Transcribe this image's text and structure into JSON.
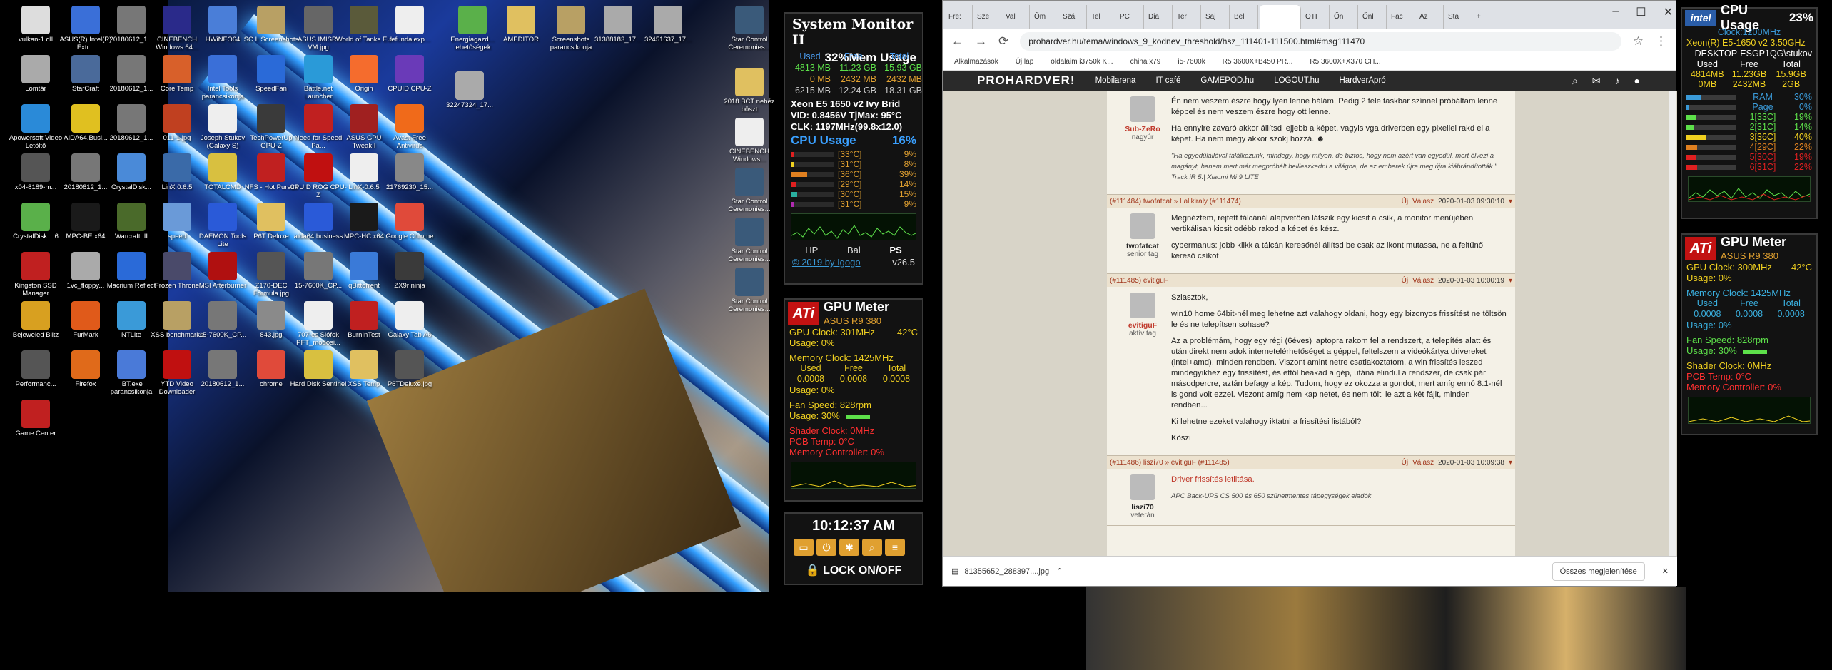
{
  "desktop_icons": [
    {
      "label": "vulkan-1.dll",
      "color": "#dddddd"
    },
    {
      "label": "ASUS(R) Intel(R) Extr...",
      "color": "#3a6fd8"
    },
    {
      "label": "20180612_1...",
      "color": "#777777"
    },
    {
      "label": "CINEBENCH Windows 64...",
      "color": "#2a2a8a"
    },
    {
      "label": "HWiNFO64",
      "color": "#4a7ed8"
    },
    {
      "label": "SC II Screenshots",
      "color": "#b8a064"
    },
    {
      "label": "ASUS IMISR-VM.jpg",
      "color": "#666666"
    },
    {
      "label": "World of Tanks EU",
      "color": "#5a5a3a"
    },
    {
      "label": "refundalexp...",
      "color": "#eeeeee"
    },
    {
      "label": "Lomtár",
      "color": "#aaaaaa"
    },
    {
      "label": "StarCraft",
      "color": "#4a6a9a"
    },
    {
      "label": "20180612_1...",
      "color": "#777777"
    },
    {
      "label": "Core Temp",
      "color": "#d8602a"
    },
    {
      "label": "Intel Tools parancsikonja",
      "color": "#3a6fd8"
    },
    {
      "label": "SpeedFan",
      "color": "#2a6ad8"
    },
    {
      "label": "Battle.net Launcher",
      "color": "#2a9ad8"
    },
    {
      "label": "Origin",
      "color": "#f56c2d"
    },
    {
      "label": "CPUID CPU-Z",
      "color": "#6a3ab8"
    },
    {
      "label": "Apowersoft Video Letöltő",
      "color": "#2a8ad8"
    },
    {
      "label": "AIDA64.Busi...",
      "color": "#e0c020"
    },
    {
      "label": "20180612_1...",
      "color": "#777777"
    },
    {
      "label": "011-1.jpg",
      "color": "#c04020"
    },
    {
      "label": "Joseph Stukov (Galaxy S)",
      "color": "#eeeeee"
    },
    {
      "label": "TechPowerUp GPU-Z",
      "color": "#3a3a3a"
    },
    {
      "label": "Need for Speed Pa...",
      "color": "#c02020"
    },
    {
      "label": "ASUS GPU TweakII",
      "color": "#a02020"
    },
    {
      "label": "Avast Free Antivirus",
      "color": "#f06a1a"
    },
    {
      "label": "x04-8189-m...",
      "color": "#555555"
    },
    {
      "label": "20180612_1...",
      "color": "#777777"
    },
    {
      "label": "CrystalDisk...",
      "color": "#4a8ad8"
    },
    {
      "label": "LinX 0.6.5",
      "color": "#3a6aa8"
    },
    {
      "label": "TOTALCMD",
      "color": "#d8c040"
    },
    {
      "label": "NFS - Hot Pursuit",
      "color": "#c02020"
    },
    {
      "label": "CPUID ROG CPU-Z",
      "color": "#c01010"
    },
    {
      "label": "LinX-0.6.5",
      "color": "#eeeeee"
    },
    {
      "label": "21769230_15...",
      "color": "#888888"
    },
    {
      "label": "CrystalDisk... 6",
      "color": "#5ab04a"
    },
    {
      "label": "MPC-BE x64",
      "color": "#1a1a1a"
    },
    {
      "label": "Warcraft III",
      "color": "#4a6a2a"
    },
    {
      "label": "speed",
      "color": "#6a9ad8"
    },
    {
      "label": "DAEMON Tools Lite",
      "color": "#2a5ad8"
    },
    {
      "label": "P6T Deluxe",
      "color": "#e0c060"
    },
    {
      "label": "aida64 business",
      "color": "#2a5ad8"
    },
    {
      "label": "MPC-HC x64",
      "color": "#1a1a1a"
    },
    {
      "label": "Google Chrome",
      "color": "#e04a3a"
    },
    {
      "label": "Kingston SSD Manager",
      "color": "#c02020"
    },
    {
      "label": "1vc_floppy...",
      "color": "#aaaaaa"
    },
    {
      "label": "Macrium Reflect",
      "color": "#2a6ad8"
    },
    {
      "label": "Frozen Throne",
      "color": "#4a4a6a"
    },
    {
      "label": "MSI Afterburner",
      "color": "#b01010"
    },
    {
      "label": "Z170-DEC Formula.jpg",
      "color": "#555555"
    },
    {
      "label": "15-7600K_CP...",
      "color": "#777777"
    },
    {
      "label": "qBittorrent",
      "color": "#3a7ad8"
    },
    {
      "label": "ZX9r ninja",
      "color": "#3a3a3a"
    },
    {
      "label": "Bejeweled Blitz",
      "color": "#d8a020"
    },
    {
      "label": "FurMark",
      "color": "#e05a1a"
    },
    {
      "label": "NTLite",
      "color": "#3a9ad8"
    },
    {
      "label": "XSS benchmarks",
      "color": "#b8a064"
    },
    {
      "label": "15-7600K_CP...",
      "color": "#777777"
    },
    {
      "label": "843.jpg",
      "color": "#8a8a8a"
    },
    {
      "label": "707-es Siófok PFT_modosi...",
      "color": "#eeeeee"
    },
    {
      "label": "BurnInTest",
      "color": "#c02020"
    },
    {
      "label": "Galaxy Tab A6",
      "color": "#eeeeee"
    },
    {
      "label": "Performanc...",
      "color": "#555555"
    },
    {
      "label": "Firefox",
      "color": "#e06a1a"
    },
    {
      "label": "IBT.exe parancsikonja",
      "color": "#4a7ad8"
    },
    {
      "label": "YTD Video Downloader",
      "color": "#c01010"
    },
    {
      "label": "20180612_1...",
      "color": "#777777"
    },
    {
      "label": "chrome",
      "color": "#e04a3a"
    },
    {
      "label": "Hard Disk Sentinel",
      "color": "#d8c040"
    },
    {
      "label": "XSS Temp",
      "color": "#e0c060"
    },
    {
      "label": "P6TDeluxe.jpg",
      "color": "#555555"
    },
    {
      "label": "Game Center",
      "color": "#c02020"
    },
    {
      "label": "Energiagazd... lehetőségek",
      "color": "#5ab04a"
    },
    {
      "label": "AMEDITOR",
      "color": "#e0c060"
    },
    {
      "label": "Screenshots parancsikonja",
      "color": "#b8a064"
    },
    {
      "label": "31388183_17...",
      "color": "#aaaaaa"
    },
    {
      "label": "32451637_17...",
      "color": "#aaaaaa"
    },
    {
      "label": "32247324_17...",
      "color": "#aaaaaa"
    },
    {
      "label": "2018 BCT nehéz böszt",
      "color": "#e0c060"
    },
    {
      "label": "CINEBENCH Windows...",
      "color": "#eeeeee"
    },
    {
      "label": "Star Control Ceremonies...",
      "color": "#3a5a7a"
    },
    {
      "label": "Star Control Ceremonies...",
      "color": "#3a5a7a"
    },
    {
      "label": "Star Control Ceremonies...",
      "color": "#3a5a7a"
    },
    {
      "label": "Star Control Ceremonies...",
      "color": "#3a5a7a"
    }
  ],
  "sysmon": {
    "title": "System Monitor II",
    "mem_label": "Mem Usage",
    "mem_pct": "32%",
    "cols": [
      "Used",
      "Free",
      "Total"
    ],
    "rows": [
      [
        "4813 MB",
        "11.23 GB",
        "15.93 GB"
      ],
      [
        "0 MB",
        "2432 MB",
        "2432 MB"
      ],
      [
        "6215 MB",
        "12.24 GB",
        "18.31 GB"
      ]
    ],
    "cpu_name": "Xeon E5 1650 v2 Ivy Brid",
    "vid": "VID: 0.8456V TjMax: 95°C",
    "clk": "CLK:  1197MHz(99.8x12.0)",
    "cpu_label": "CPU Usage",
    "cpu_pct": "16%",
    "cores": [
      {
        "temp": "[33°C]",
        "pct": "9%",
        "color": "#e02020",
        "level": 9
      },
      {
        "temp": "[31°C]",
        "pct": "8%",
        "color": "#f0d020",
        "level": 8
      },
      {
        "temp": "[36°C]",
        "pct": "39%",
        "color": "#e08020",
        "level": 39
      },
      {
        "temp": "[29°C]",
        "pct": "14%",
        "color": "#e02020",
        "level": 14
      },
      {
        "temp": "[30°C]",
        "pct": "15%",
        "color": "#2ab0a0",
        "level": 15
      },
      {
        "temp": "[31°C]",
        "pct": "9%",
        "color": "#b02ab0",
        "level": 9
      }
    ],
    "footer": [
      "HP",
      "Bal",
      "PS"
    ],
    "copyright": "© 2019 by Igogo",
    "version": "v26.5"
  },
  "gpu_left": {
    "title": "GPU Meter",
    "model": "ASUS R9 380",
    "clock": "GPU Clock: 301MHz",
    "temp": "42°C",
    "usage": "Usage: 0%",
    "memclock": "Memory Clock: 1425MHz",
    "cols": [
      "Used",
      "Free",
      "Total"
    ],
    "vals": [
      "0.0008",
      "0.0008",
      "0.0008"
    ],
    "musage": "Usage: 0%",
    "fan": "Fan Speed: 828rpm",
    "fan_usage": "Usage: 30%",
    "fan_level": 30,
    "shader": "Shader Clock: 0MHz",
    "pcb": "PCB Temp: 0°C",
    "memctrl": "Memory Controller: 0%"
  },
  "clock": {
    "time": "10:12:37 AM",
    "lock": "LOCK ON/OFF"
  },
  "browser": {
    "tabs": [
      "Fre:",
      "Sze",
      "Val",
      "Őm",
      "Szá",
      "Tel",
      "PC",
      "Dia",
      "Ter",
      "Saj",
      "Bel",
      "",
      "OTI",
      "Őn",
      "Őnl",
      "Fac",
      "Az",
      "Sta"
    ],
    "url": "prohardver.hu/tema/windows_9_kodnev_threshold/hsz_111401-111500.html#msg111470",
    "bookmarks": [
      "Alkalmazások",
      "Új lap",
      "oldalaim i3750k K...",
      "china x79",
      "i5-7600k",
      "R5 3600X+B450 PR...",
      "R5 3600X+X370 CH..."
    ],
    "nav": [
      "PROHARDVER!",
      "Mobilarena",
      "IT café",
      "GAMEPOD.hu",
      "LOGOUT.hu",
      "HardverApró"
    ],
    "download_file": "81355652_288397....jpg",
    "download_btn": "Összes megjelenítése"
  },
  "posts": [
    {
      "bar": null,
      "user": "Sub-ZeRo",
      "rank": "nagyúr",
      "red": true,
      "paras": [
        "Én nem veszem észre hogy lyen lenne hálám. Pedig 2 féle taskbar színnel próbáltam lenne képpel és nem veszem észre hogy ott lenne.",
        "Ha ennyire zavaró akkor állítsd lejjebb a képet, vagyis vga driverben egy pixellel rakd el a képet. Ha nem megy akkor szokj hozzá. ☻"
      ],
      "sig": "\"Ha egyedülállóval találkozunk, mindegy, hogy milyen, de biztos, hogy nem azért van egyedül, mert élvezi a magányt, hanem mert már megpróbált beilleszkedni a világba, de az emberek újra meg újra kiábrándították.\" Track iR 5.| Xiaomi Mi 9 LITE"
    },
    {
      "bar": "(#111484) twofatcat » Lalikiraly (#111474)",
      "date": "2020-01-03 09:30:10",
      "user": "twofatcat",
      "rank": "senior tag",
      "red": false,
      "paras": [
        "Megnéztem, rejtett tálcánál alapvetően látszik egy kicsit a csík, a monitor menüjében vertikálisan kicsit odébb rakod a képet és kész.",
        "cybermanus: jobb klikk a tálcán keresőnél állítsd be csak az ikont mutassa, ne a feltűnő kereső csíkot"
      ],
      "sig": ""
    },
    {
      "bar": "(#111485) evitiguF",
      "date": "2020-01-03 10:00:19",
      "user": "evitiguF",
      "rank": "aktív tag",
      "red": true,
      "paras": [
        "Sziasztok,",
        "win10 home 64bit-nél meg lehetne azt valahogy oldani, hogy egy bizonyos frissítést ne töltsön le és ne telepítsen sohase?",
        "Az a problémám, hogy egy régi (6éves) laptopra rakom fel a rendszert, a telepítés alatt és után direkt nem adok internetelérhetőséget a géppel, feltelszem a videókártya drivereket (intel+amd), minden rendben. Viszont amint netre csatlakoztatom, a win frissítés leszed mindegyikhez egy frissítést, és ettől beakad a gép, utána elindul a rendszer, de csak pár másodpercre, aztán befagy a kép. Tudom, hogy ez okozza a gondot, mert amíg ennó 8.1-nél is gond volt ezzel. Viszont amíg nem kap netet, és nem tölti le azt a két fájlt, minden rendben...",
        "Ki lehetne ezeket valahogy iktatni a frissítési listából?",
        "Köszi"
      ],
      "sig": ""
    },
    {
      "bar": "(#111486) liszi70 » evitiguF (#111485)",
      "date": "2020-01-03 10:09:38",
      "user": "liszi70",
      "rank": "veterán",
      "red": false,
      "paras": [
        "Driver frissítés letiltása."
      ],
      "sig": "APC Back-UPS CS 500 és 650 szünetmentes tápegységek eladók"
    }
  ],
  "post_actions": [
    "Új",
    "Válasz"
  ],
  "cpu_right": {
    "title": "CPU Usage",
    "pct": "23%",
    "clock": "Clock:1200MHz",
    "cpu": "Xeon(R) E5-1650 v2 3.50GHz",
    "host": "DESKTOP-ESGP1QG\\stukov",
    "cols": [
      "Used",
      "Free",
      "Total"
    ],
    "v1": [
      "4814MB",
      "11.23GB",
      "15.9GB"
    ],
    "v2": [
      "0MB",
      "2432MB",
      "2GB"
    ],
    "bars": [
      {
        "name": "RAM",
        "pct": "30%",
        "color": "#3a9ad8",
        "level": 30
      },
      {
        "name": "Page",
        "pct": "0%",
        "color": "#3a9ad8",
        "level": 0
      },
      {
        "name": "1[33C]",
        "pct": "19%",
        "color": "#5de04a",
        "level": 19
      },
      {
        "name": "2[31C]",
        "pct": "14%",
        "color": "#5de04a",
        "level": 14
      },
      {
        "name": "3[36C]",
        "pct": "40%",
        "color": "#f0d020",
        "level": 40
      },
      {
        "name": "4[29C]",
        "pct": "22%",
        "color": "#e08020",
        "level": 22
      },
      {
        "name": "5[30C]",
        "pct": "19%",
        "color": "#e02020",
        "level": 19
      },
      {
        "name": "6[31C]",
        "pct": "22%",
        "color": "#e02020",
        "level": 22
      }
    ]
  },
  "gpu_right": {
    "title": "GPU Meter",
    "model": "ASUS R9 380",
    "clock": "GPU Clock: 300MHz",
    "temp": "42°C",
    "usage": "Usage: 0%",
    "memclock": "Memory Clock: 1425MHz",
    "cols": [
      "Used",
      "Free",
      "Total"
    ],
    "vals": [
      "0.0008",
      "0.0008",
      "0.0008"
    ],
    "musage": "Usage: 0%",
    "fan": "Fan Speed: 828rpm",
    "fan_usage": "Usage: 30%",
    "fan_level": 30,
    "shader": "Shader Clock: 0MHz",
    "pcb": "PCB Temp: 0°C",
    "memctrl": "Memory Controller: 0%"
  }
}
